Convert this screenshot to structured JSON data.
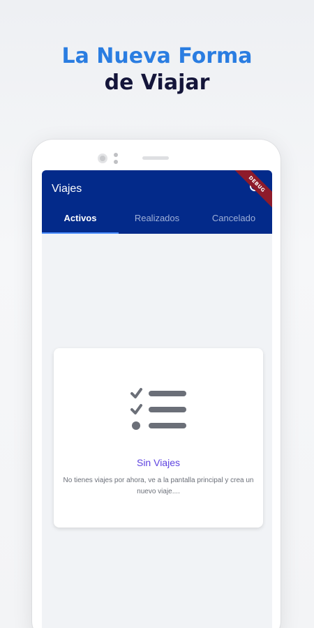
{
  "promo": {
    "headline_line1": "La Nueva Forma",
    "headline_line2": "de Viajar",
    "accent_color": "#2a7de1",
    "dark_color": "#14153a"
  },
  "app": {
    "title": "Viajes",
    "debug_banner": "DEBUG",
    "appbar_color": "#032a8a",
    "search_icon": "search-icon"
  },
  "tabs": [
    {
      "label": "Activos",
      "active": true
    },
    {
      "label": "Realizados",
      "active": false
    },
    {
      "label": "Cancelado",
      "active": false
    }
  ],
  "empty_state": {
    "icon": "checklist-icon",
    "title": "Sin Viajes",
    "message": "No tienes viajes por ahora, ve a la pantalla principal y crea un nuevo viaje....",
    "title_color": "#5e43e0"
  }
}
